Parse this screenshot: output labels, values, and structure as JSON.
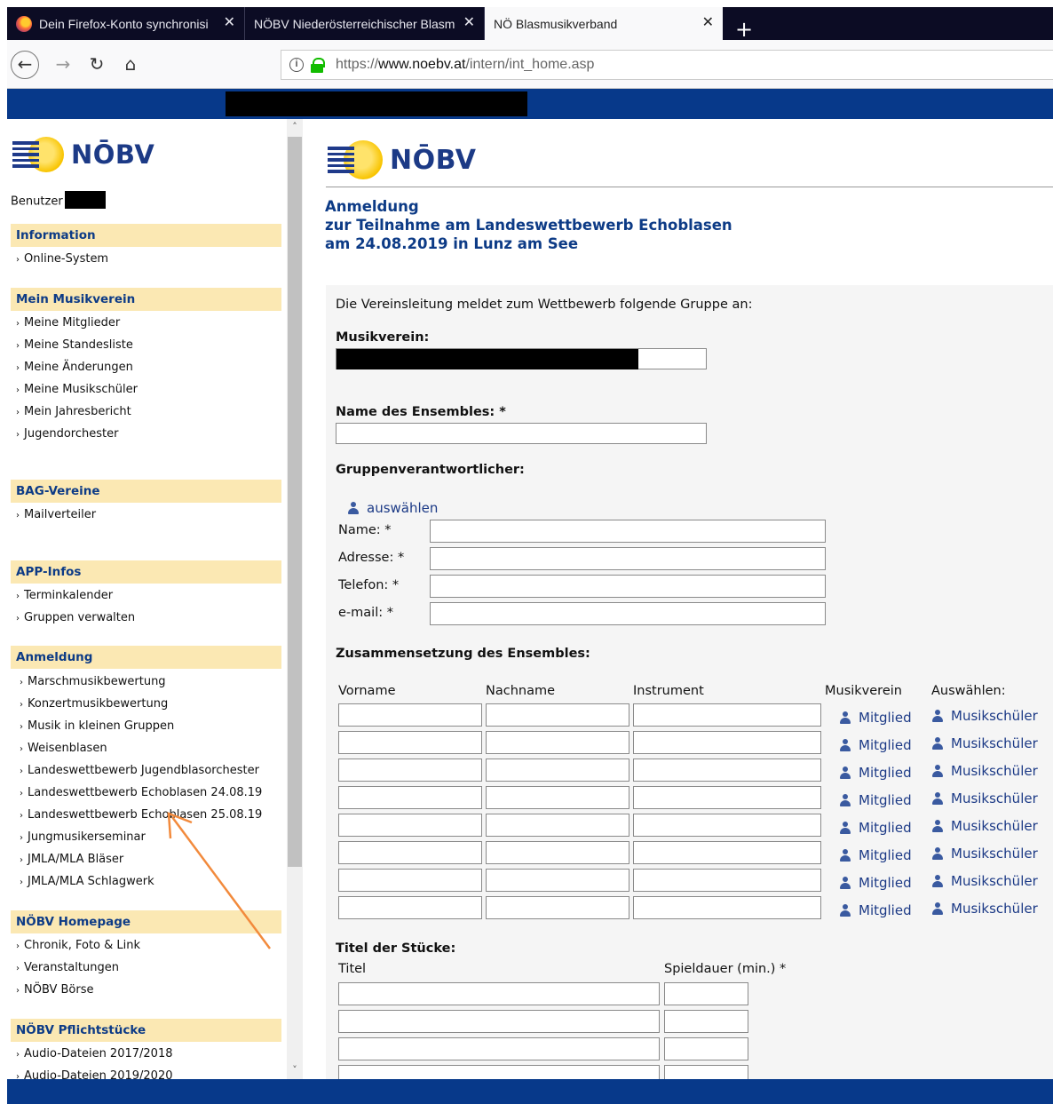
{
  "browser": {
    "tabs": [
      {
        "label": "Dein Firefox-Konto synchronisi",
        "close": "✕"
      },
      {
        "label": "NÖBV Niederösterreichischer Blasm",
        "close": "✕"
      },
      {
        "label": "NÖ Blasmusikverband",
        "close": "✕"
      }
    ],
    "new_tab": "+",
    "url_host": "www.noebv.at",
    "url_prefix": "https://",
    "url_path": "/intern/int_home.asp",
    "info_glyph": "i",
    "back_glyph": "←",
    "forward_glyph": "→",
    "reload_glyph": "↻",
    "home_glyph": "⌂"
  },
  "logo_text": "NŌBV",
  "sidebar": {
    "user_label": "Benutzer",
    "sections": [
      {
        "title": "Information",
        "items": [
          "Online-System"
        ]
      },
      {
        "title": "Mein Musikverein",
        "items": [
          "Meine Mitglieder",
          "Meine Standesliste",
          "Meine Änderungen",
          "Meine Musikschüler",
          "Mein Jahresbericht",
          "Jugendorchester"
        ]
      },
      {
        "title": "BAG-Vereine",
        "items": [
          "Mailverteiler"
        ]
      },
      {
        "title": "APP-Infos",
        "items": [
          "Terminkalender",
          "Gruppen verwalten"
        ]
      },
      {
        "title": "Anmeldung",
        "items": [
          "Marschmusikbewertung",
          "Konzertmusikbewertung",
          "Musik in kleinen Gruppen",
          "Weisenblasen",
          "Landeswettbewerb Jugendblasorchester",
          "Landeswettbewerb Echoblasen 24.08.19",
          "Landeswettbewerb Echoblasen 25.08.19",
          "Jungmusikerseminar",
          "JMLA/MLA Bläser",
          "JMLA/MLA Schlagwerk"
        ]
      },
      {
        "title": "NÖBV Homepage",
        "items": [
          "Chronik, Foto & Link",
          "Veranstaltungen",
          "NÖBV Börse"
        ]
      },
      {
        "title": "NÖBV Pflichtstücke",
        "items": [
          "Audio-Dateien 2017/2018",
          "Audio-Dateien 2019/2020"
        ]
      }
    ],
    "bullet": "›",
    "scroll_up": "˄",
    "scroll_down": "˅"
  },
  "main": {
    "heading": [
      "Anmeldung",
      "zur Teilnahme am Landeswettbewerb Echoblasen",
      "am 24.08.2019 in Lunz am See"
    ],
    "intro": "Die Vereinsleitung meldet zum Wettbewerb folgende Gruppe an:",
    "musikverein_label": "Musikverein:",
    "ensemble_name_label": "Name des Ensembles: *",
    "responsible_label": "Gruppenverantwortlicher:",
    "select_link": "auswählen",
    "contact_fields": [
      "Name: *",
      "Adresse: *",
      "Telefon: *",
      "e-mail: *"
    ],
    "composition_label": "Zusammensetzung des Ensembles:",
    "columns": [
      "Vorname",
      "Nachname",
      "Instrument",
      "Musikverein",
      "Auswählen:"
    ],
    "member_link": "Mitglied",
    "student_link": "Musikschüler",
    "member_rows": 8,
    "pieces_label": "Titel der Stücke:",
    "pieces_columns": [
      "Titel",
      "Spieldauer (min.) *"
    ],
    "piece_rows": 4
  }
}
